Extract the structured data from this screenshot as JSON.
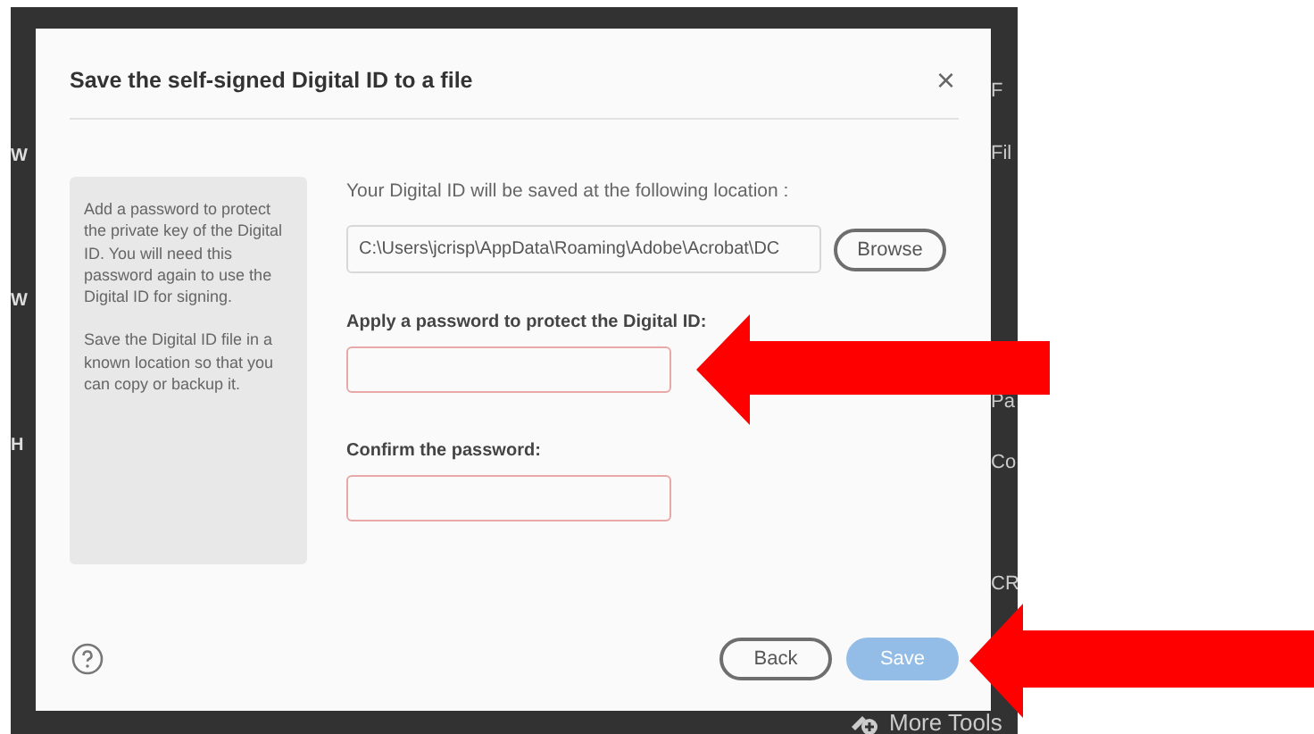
{
  "background_app": {
    "left_fragments": [
      "W",
      "W",
      "H"
    ],
    "right_fragments": [
      "F",
      "Fil",
      "Pa",
      "Co",
      "CR"
    ],
    "more_tools": "More Tools"
  },
  "dialog": {
    "title": "Save the self-signed Digital ID to a file",
    "close": "×",
    "info_paragraphs": [
      "Add a password to protect the private key of the Digital ID. You will need this password again to use the Digital ID for signing.",
      "Save the Digital ID file in a known location so that you can copy or backup it."
    ],
    "location_label": "Your Digital ID will be saved at the following location :",
    "location_value": "C:\\Users\\jcrisp\\AppData\\Roaming\\Adobe\\Acrobat\\DC",
    "browse": "Browse",
    "password_label": "Apply a password to protect the Digital ID:",
    "confirm_label": "Confirm the password:",
    "back": "Back",
    "save": {
      "label": "Save",
      "disabled": true
    }
  },
  "annotations": [
    {
      "kind": "arrow"
    },
    {
      "kind": "arrow"
    }
  ]
}
